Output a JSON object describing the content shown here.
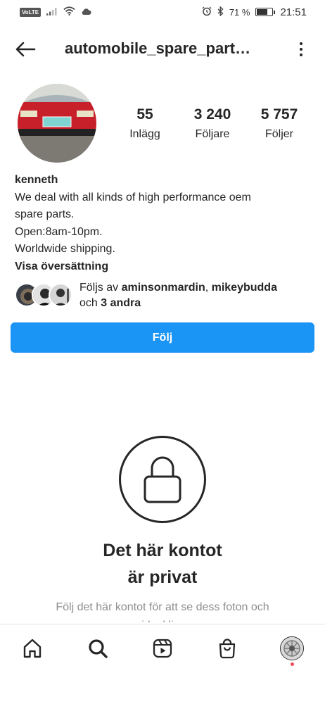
{
  "status_bar": {
    "volte": "VoLTE",
    "battery_percent": "71 %",
    "battery_level": 0.71,
    "time": "21:51",
    "icons": [
      "signal-icon",
      "wifi-icon",
      "cloud-icon",
      "alarm-icon",
      "bluetooth-icon",
      "battery-icon"
    ]
  },
  "top_bar": {
    "username": "automobile_spare_part…",
    "back_icon": "back-arrow-icon",
    "more_icon": "more-vertical-icon"
  },
  "stats": [
    {
      "value": "55",
      "label": "Inlägg"
    },
    {
      "value": "3 240",
      "label": "Följare"
    },
    {
      "value": "5 757",
      "label": "Följer"
    }
  ],
  "bio": {
    "name": "kenneth",
    "lines": [
      "We deal with all kinds of high performance oem",
      "spare parts.",
      "Open:8am-10pm.",
      "Worldwide shipping."
    ],
    "translate": "Visa översättning"
  },
  "followed_by": {
    "prefix": "Följs av ",
    "user1": "aminsonmardin",
    "separator": ", ",
    "user2": "mikeybudda",
    "and_text": "och ",
    "others": "3 andra"
  },
  "follow_button": "Följ",
  "private": {
    "title_line1": "Det här kontot",
    "title_line2": "är privat",
    "subtitle": "Följ det här kontot för att se dess foton och videoklipp."
  },
  "bottom_nav": [
    "home-icon",
    "search-icon",
    "reels-icon",
    "shop-icon",
    "profile-avatar"
  ],
  "colors": {
    "accent": "#1a94f5",
    "text": "#262626",
    "muted": "#8e8e8e",
    "notification": "#ed4956"
  }
}
